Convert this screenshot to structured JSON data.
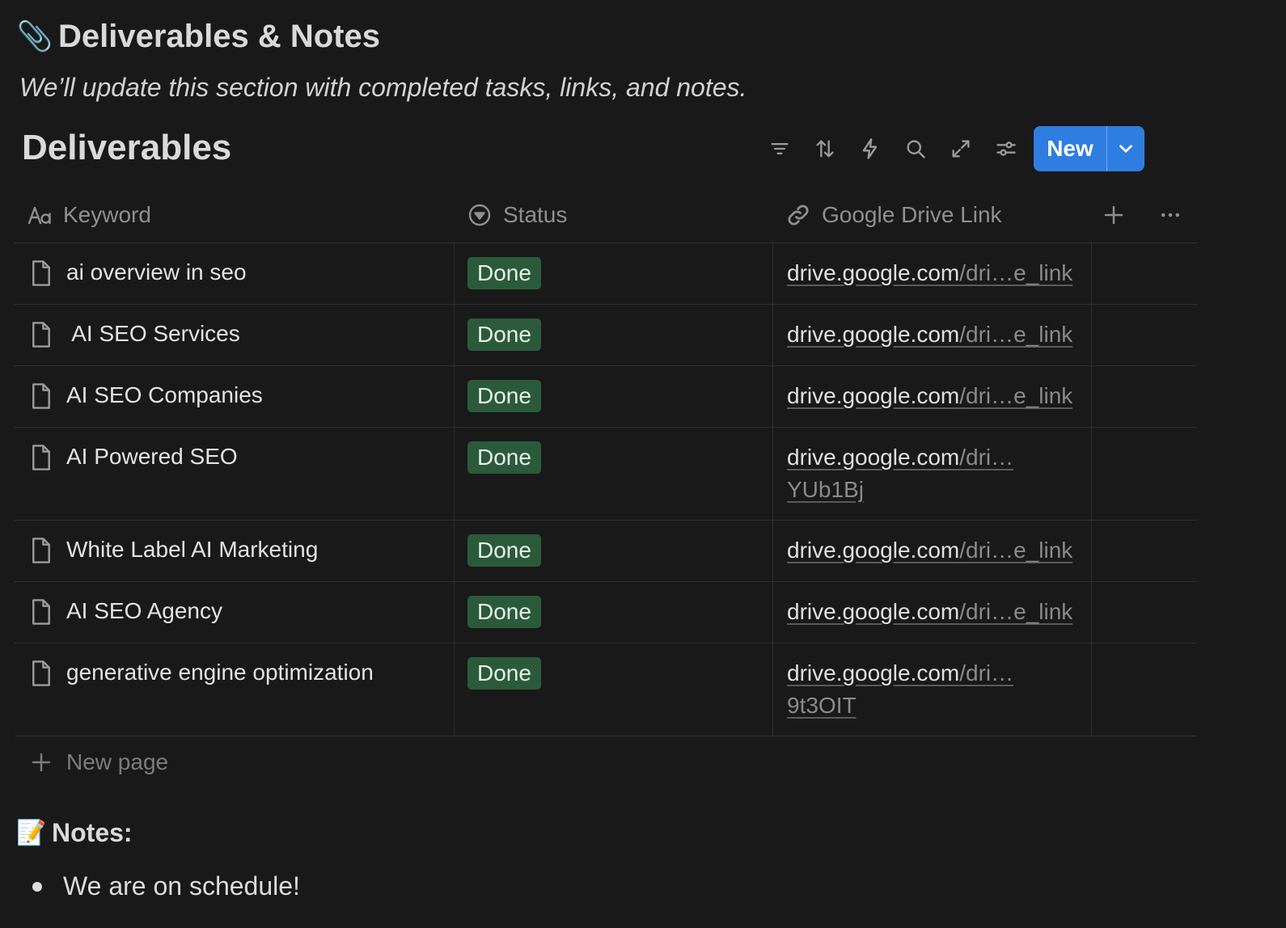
{
  "page": {
    "heading_emoji": "📎",
    "heading": "Deliverables & Notes",
    "subtitle": "We’ll update this section with completed tasks, links, and notes."
  },
  "database": {
    "title": "Deliverables",
    "toolbar": {
      "icons": [
        "filter-icon",
        "sort-icon",
        "automation-icon",
        "search-icon",
        "expand-icon",
        "settings-icon"
      ],
      "new_label": "New"
    },
    "columns": [
      {
        "label": "Keyword",
        "icon": "text-type-icon"
      },
      {
        "label": "Status",
        "icon": "status-icon"
      },
      {
        "label": "Google Drive Link",
        "icon": "link-icon"
      }
    ],
    "rows": [
      {
        "keyword": "ai overview in seo",
        "status": "Done",
        "domain": "drive.google.com",
        "rest": "/dri…e_link",
        "cont": ""
      },
      {
        "keyword": " AI SEO Services",
        "status": "Done",
        "domain": "drive.google.com",
        "rest": "/dri…e_link",
        "cont": ""
      },
      {
        "keyword": "AI SEO Companies",
        "status": "Done",
        "domain": "drive.google.com",
        "rest": "/dri…e_link",
        "cont": ""
      },
      {
        "keyword": "AI Powered SEO",
        "status": "Done",
        "domain": "drive.google.com",
        "rest": "/dri…",
        "cont": "YUb1Bj"
      },
      {
        "keyword": "White Label AI Marketing",
        "status": "Done",
        "domain": "drive.google.com",
        "rest": "/dri…e_link",
        "cont": ""
      },
      {
        "keyword": "AI SEO Agency",
        "status": "Done",
        "domain": "drive.google.com",
        "rest": "/dri…e_link",
        "cont": ""
      },
      {
        "keyword": "generative engine optimization",
        "status": "Done",
        "domain": "drive.google.com",
        "rest": "/dri…",
        "cont": "9t3OIT"
      }
    ],
    "new_page_label": "New page"
  },
  "notes": {
    "emoji": "📝",
    "heading": "Notes:",
    "items": [
      "We are on schedule!"
    ]
  },
  "colors": {
    "background": "#191919",
    "accent": "#2f7de1",
    "done_badge": "#2b5a3a"
  }
}
